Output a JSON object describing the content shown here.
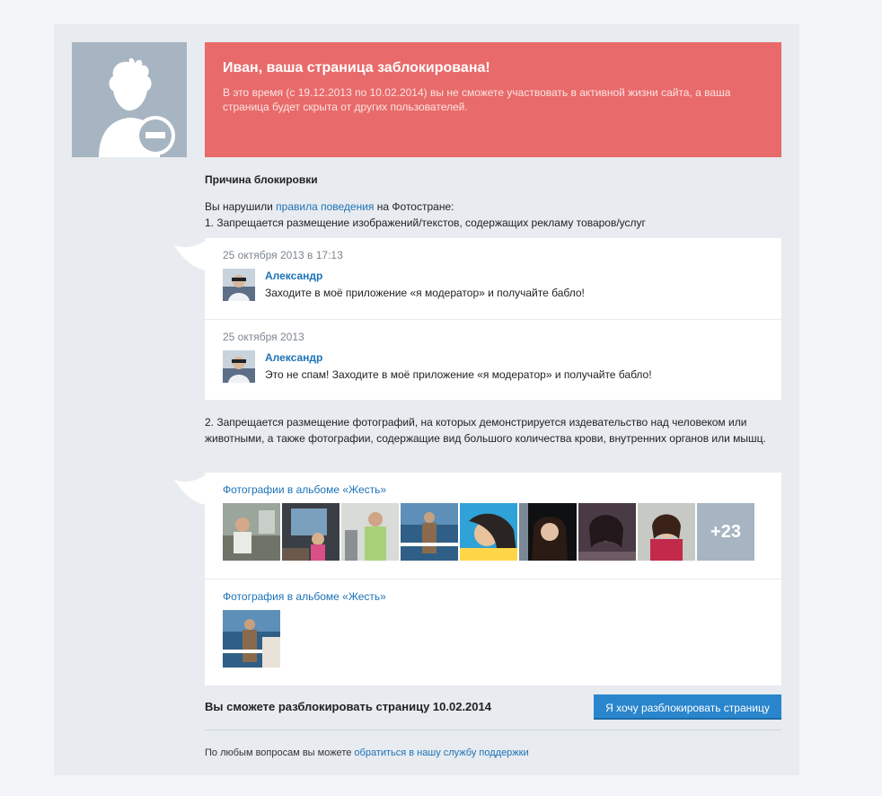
{
  "alert": {
    "title": "Иван, ваша страница заблокирована!",
    "text": "В это время (с 19.12.2013 по 10.02.2014) вы не сможете участвовать в активной жизни сайта, а ваша страница будет скрыта от других пользователей."
  },
  "reason": {
    "title": "Причина блокировки",
    "intro_prefix": "Вы нарушили ",
    "intro_link": "правила поведения",
    "intro_suffix": " на Фотостране:",
    "rule1": "1. Запрещается размещение изображений/текстов, содержащих рекламу товаров/услуг",
    "rule2": "2. Запрещается размещение фотографий, на которых демонстрируется издевательство над человеком или животными, а также фотографии, содержащие вид большого количества крови, внутренних органов или мышц."
  },
  "messages": [
    {
      "date": "25 октября 2013 в 17:13",
      "author": "Александр",
      "text": "Заходите в моё приложение «я модератор» и получайте бабло!"
    },
    {
      "date": "25 октября 2013",
      "author": "Александр",
      "text": "Это не спам! Заходите в моё приложение «я модератор» и получайте бабло!"
    }
  ],
  "albums": [
    {
      "link": "Фотографии в альбоме «Жесть»",
      "photo_count": 8,
      "more": "+23"
    },
    {
      "link": "Фотография в альбоме «Жесть»",
      "photo_count": 1
    }
  ],
  "unlock": {
    "text": "Вы сможете разблокировать страницу 10.02.2014",
    "button": "Я хочу разблокировать страницу"
  },
  "support": {
    "prefix": "По любым вопросам вы можете ",
    "link": "обратиться в нашу службу поддержки"
  },
  "colors": {
    "alert_bg": "#e86a6a",
    "link": "#1c73b8",
    "button": "#2a86cc",
    "avatar_bg": "#a7b4c1"
  }
}
